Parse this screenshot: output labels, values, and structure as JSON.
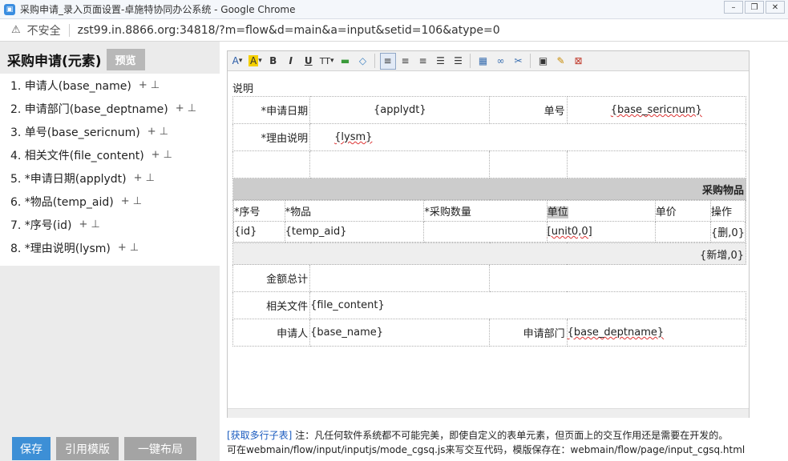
{
  "window": {
    "title": "采购申请_录入页面设置-卓施特协同办公系统 - Google Chrome",
    "not_secure": "不安全",
    "url": "zst99.in.8866.org:34818/?m=flow&d=main&a=input&setid=106&atype=0"
  },
  "left": {
    "title": "采购申请(元素)",
    "preview": "预览",
    "fields": [
      {
        "label": "1. 申请人(base_name)"
      },
      {
        "label": "2. 申请部门(base_deptname)"
      },
      {
        "label": "3. 单号(base_sericnum)"
      },
      {
        "label": "4. 相关文件(file_content)"
      },
      {
        "label": "5. *申请日期(applydt)"
      },
      {
        "label": "6. *物品(temp_aid)"
      },
      {
        "label": "7. *序号(id)"
      },
      {
        "label": "8. *理由说明(lysm)"
      }
    ],
    "field_ops": "+  ⊥",
    "buttons": {
      "save": "保存",
      "template": "引用模版",
      "layout": "一键布局"
    }
  },
  "toolbar": {
    "items": [
      "A",
      "A",
      "B",
      "I",
      "U",
      "TT",
      "+",
      "◇",
      "≡",
      "≡",
      "≡",
      "≡",
      "≡",
      "▦",
      "∞",
      "✂",
      "▣",
      "✎",
      "⊠"
    ]
  },
  "doc": {
    "label": "说明",
    "row1": {
      "c1": "*申请日期",
      "c2": "{applydt}",
      "c3": "单号",
      "c4": "{base_sericnum}"
    },
    "row2": {
      "c1": "*理由说明",
      "c2": "{lysm}"
    },
    "section": "采购物品",
    "sub_head": [
      "*序号",
      "*物品",
      "*采购数量",
      "单位",
      "单价",
      "操作"
    ],
    "sub_row": [
      "{id}",
      "{temp_aid}",
      "",
      "[unit0,0]",
      "",
      "{删,0}"
    ],
    "add_row": "{新增,0}",
    "total_label": "金额总计",
    "file_label": "相关文件",
    "file_value": "{file_content}",
    "applicant_label": "申请人",
    "applicant_value": "{base_name}",
    "dept_label": "申请部门",
    "dept_value": "{base_deptname}"
  },
  "note": {
    "link": "[获取多行子表]",
    "line1": "注：凡任何软件系统都不可能完美，即使自定义的表单元素，但页面上的交互作用还是需要在开发的。",
    "line2": "可在webmain/flow/input/inputjs/mode_cgsq.js来写交互代码，模版保存在：webmain/flow/page/input_cgsq.html"
  }
}
